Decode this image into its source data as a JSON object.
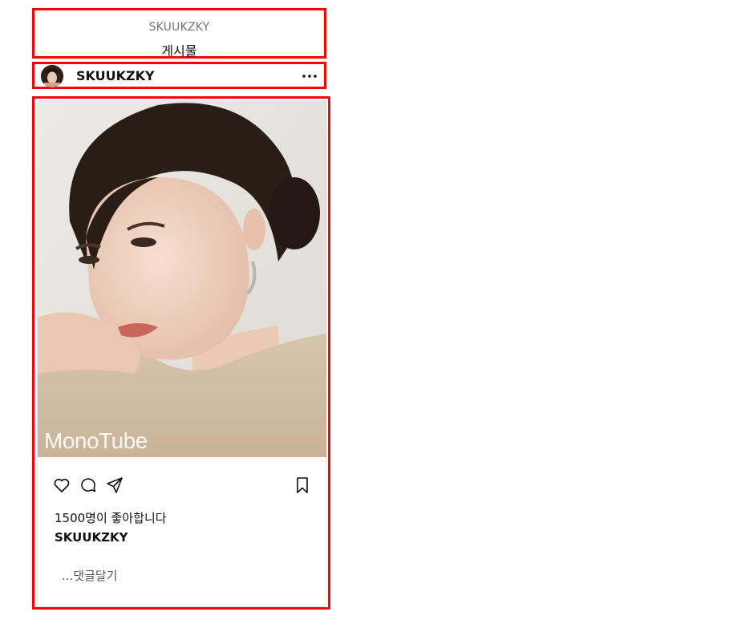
{
  "header": {
    "username": "SKUUKZKY",
    "title": "게시물"
  },
  "post_header": {
    "username": "SKUUKZKY",
    "more_icon": "more-horizontal-icon"
  },
  "post": {
    "image_watermark": "MonoTube",
    "actions": {
      "like_icon": "heart-icon",
      "comment_icon": "comment-icon",
      "share_icon": "send-icon",
      "save_icon": "bookmark-icon"
    },
    "likes_text": "1500명이 좋아합니다",
    "caption_username": "SKUUKZKY",
    "add_comment_text": "...댓글달기"
  },
  "colors": {
    "highlight_border": "#ff0000",
    "muted_text": "#737373",
    "text": "#111111"
  }
}
